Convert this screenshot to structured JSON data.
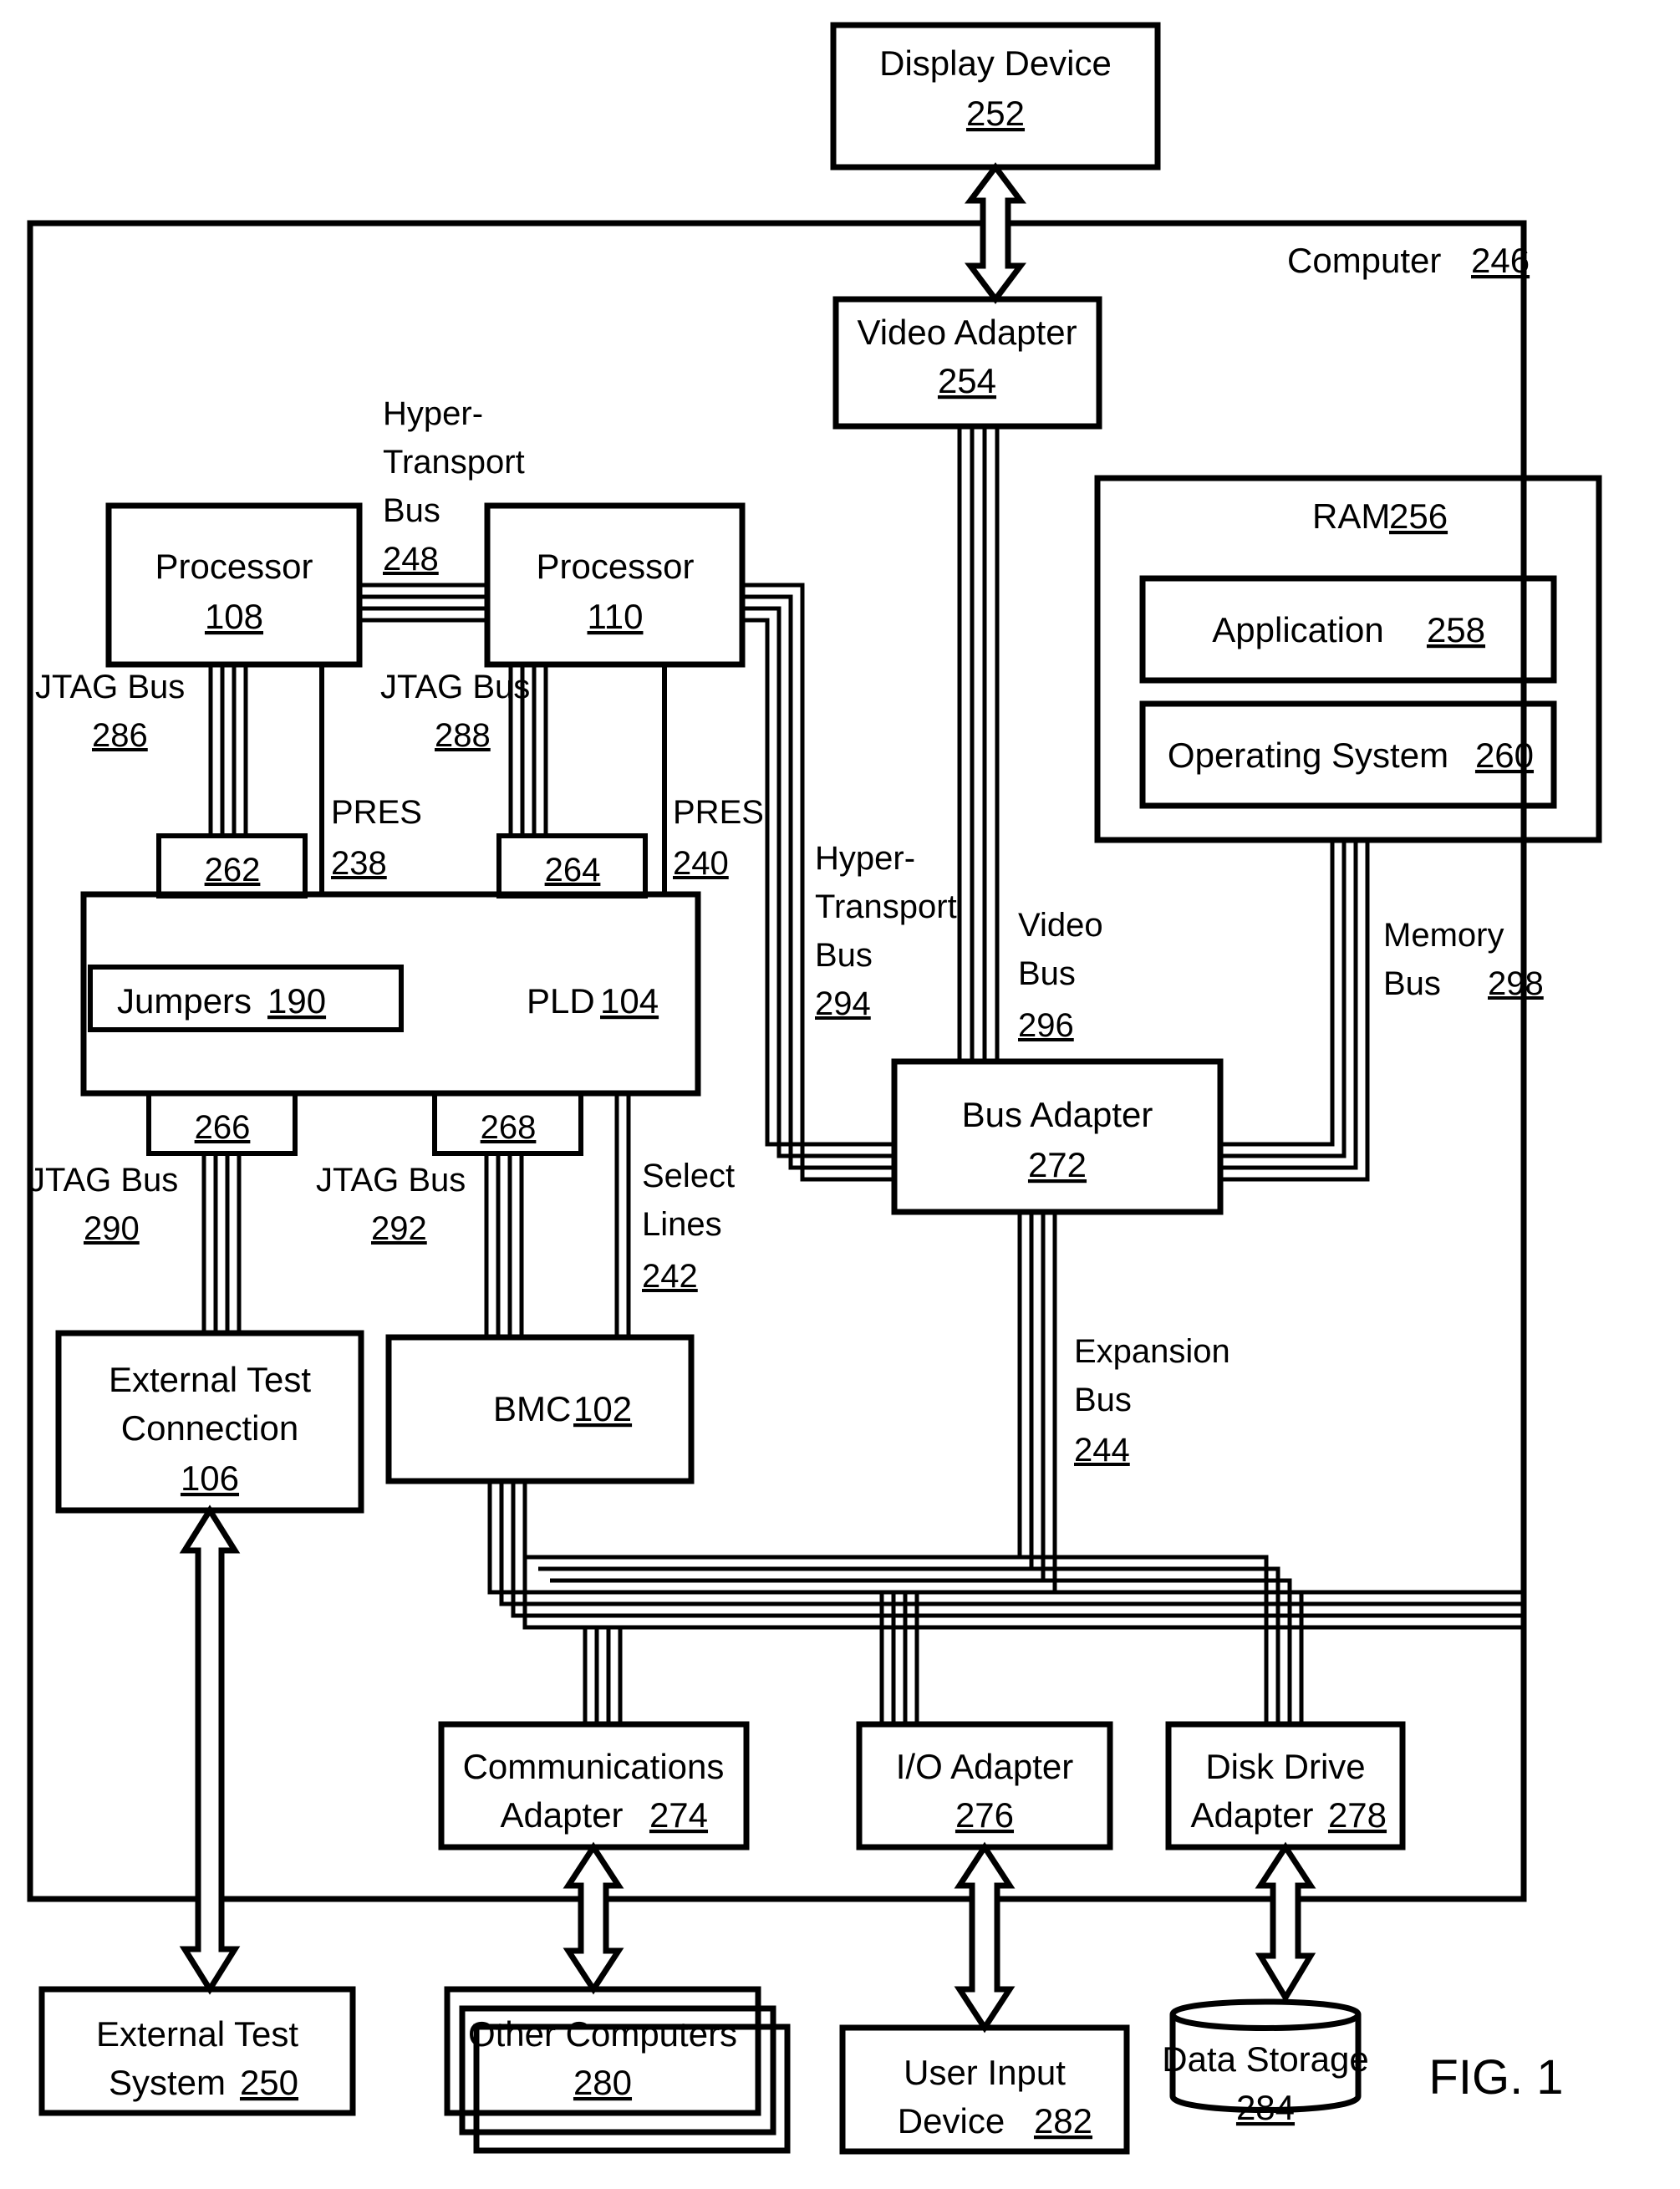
{
  "figure": {
    "caption": "FIG. 1"
  },
  "outer": {
    "label": "Computer",
    "ref": "246"
  },
  "blocks": {
    "display_device": {
      "label": "Display Device",
      "ref": "252"
    },
    "video_adapter": {
      "label": "Video Adapter",
      "ref": "254"
    },
    "processor_108": {
      "label": "Processor",
      "ref": "108"
    },
    "processor_110": {
      "label": "Processor",
      "ref": "110"
    },
    "ram": {
      "label": "RAM",
      "ref": "256"
    },
    "application": {
      "label": "Application",
      "ref": "258"
    },
    "operating_system": {
      "label": "Operating System",
      "ref": "260"
    },
    "pld": {
      "label": "PLD",
      "ref": "104"
    },
    "jumpers": {
      "label": "Jumpers",
      "ref": "190"
    },
    "bus_adapter": {
      "label": "Bus Adapter",
      "ref": "272"
    },
    "ext_test_conn": {
      "label": "External Test Connection",
      "line1": "External Test",
      "line2": "Connection",
      "ref": "106"
    },
    "bmc": {
      "label": "BMC",
      "ref": "102"
    },
    "comm_adapter": {
      "label": "Communications Adapter",
      "line1": "Communications",
      "line2": "Adapter",
      "ref": "274"
    },
    "io_adapter": {
      "label": "I/O Adapter",
      "ref": "276"
    },
    "disk_drive_adapter": {
      "label": "Disk Drive Adapter",
      "line1": "Disk Drive",
      "line2": "Adapter",
      "ref": "278"
    },
    "ext_test_system": {
      "label": "External Test System",
      "line1": "External Test",
      "line2": "System",
      "ref": "250"
    },
    "other_computers": {
      "label": "Other Computers",
      "ref": "280"
    },
    "user_input_device": {
      "label": "User Input Device",
      "line1": "User Input",
      "line2": "Device",
      "ref": "282"
    },
    "data_storage": {
      "label": "Data Storage",
      "ref": "284"
    }
  },
  "connectors": {
    "conn_262": {
      "ref": "262"
    },
    "conn_264": {
      "ref": "264"
    },
    "conn_266": {
      "ref": "266"
    },
    "conn_268": {
      "ref": "268"
    }
  },
  "bus_labels": {
    "hypertransport_248": {
      "line1": "Hyper-",
      "line2": "Transport",
      "line3": "Bus",
      "ref": "248"
    },
    "jtag_286": {
      "line1": "JTAG Bus",
      "ref": "286"
    },
    "jtag_288": {
      "line1": "JTAG Bus",
      "ref": "288"
    },
    "jtag_290": {
      "line1": "JTAG Bus",
      "ref": "290"
    },
    "jtag_292": {
      "line1": "JTAG Bus",
      "ref": "292"
    },
    "pres_238": {
      "line1": "PRES",
      "ref": "238"
    },
    "pres_240": {
      "line1": "PRES",
      "ref": "240"
    },
    "select_lines_242": {
      "line1": "Select",
      "line2": "Lines",
      "ref": "242"
    },
    "hypertransport_294": {
      "line1": "Hyper-",
      "line2": "Transport",
      "line3": "Bus",
      "ref": "294"
    },
    "video_bus_296": {
      "line1": "Video",
      "line2": "Bus",
      "ref": "296"
    },
    "memory_bus_298": {
      "line1": "Memory",
      "line2": "Bus",
      "ref": "298"
    },
    "expansion_bus_244": {
      "line1": "Expansion",
      "line2": "Bus",
      "ref": "244"
    }
  },
  "colors": {
    "stroke": "#000000",
    "fill": "#ffffff",
    "background": "#ffffff"
  }
}
